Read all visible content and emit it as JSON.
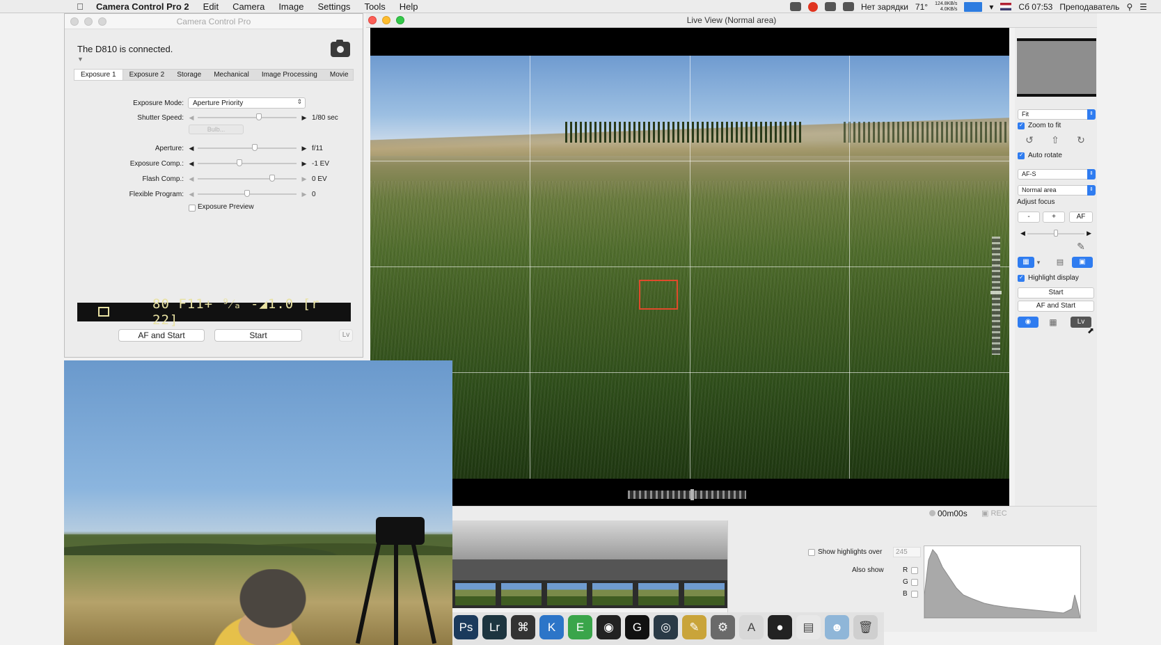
{
  "menubar": {
    "app_name": "Camera Control Pro 2",
    "items": [
      "Edit",
      "Camera",
      "Image",
      "Settings",
      "Tools",
      "Help"
    ],
    "status": {
      "battery": "Нет зарядки",
      "temperature": "71°",
      "net_up": "124.8KB/s",
      "net_down": "4.0KB/s",
      "clock": "Сб 07:53",
      "user": "Преподаватель"
    }
  },
  "ccp": {
    "title": "Camera Control Pro",
    "connection": "The D810 is connected.",
    "tabs": [
      "Exposure 1",
      "Exposure 2",
      "Storage",
      "Mechanical",
      "Image Processing",
      "Movie"
    ],
    "exposure_mode": {
      "label": "Exposure Mode:",
      "value": "Aperture Priority"
    },
    "shutter_speed": {
      "label": "Shutter Speed:",
      "value": "1/80 sec",
      "level": 0.62
    },
    "bulb_label": "Bulb...",
    "aperture": {
      "label": "Aperture:",
      "value": "f/11",
      "level": 0.58
    },
    "exposure_comp": {
      "label": "Exposure Comp.:",
      "value": "-1 EV",
      "level": 0.42
    },
    "flash_comp": {
      "label": "Flash Comp.:",
      "value": "0 EV",
      "level": 0.75
    },
    "flexible_program": {
      "label": "Flexible Program:",
      "value": "0",
      "level": 0.5
    },
    "exposure_preview": "Exposure Preview",
    "lcd_readout": "80 F11+ ⁹⁄ₐ -◢1.0 [r 22]",
    "buttons": {
      "af_and_start": "AF and Start",
      "start": "Start",
      "lv": "Lv"
    }
  },
  "live_view": {
    "title": "Live View (Normal area)",
    "timer": "00m00s",
    "rec_label": "REC"
  },
  "right_panel": {
    "zoom_select": "Fit",
    "zoom_to_fit": "Zoom to fit",
    "auto_rotate": "Auto rotate",
    "focus_mode": "AF-S",
    "area_mode": "Normal area",
    "adjust_focus": "Adjust focus",
    "focus_minus": "-",
    "focus_plus": "+",
    "focus_af": "AF",
    "highlight_display": "Highlight display",
    "start": "Start",
    "af_and_start": "AF and Start",
    "lv_button": "Lv"
  },
  "histogram": {
    "show_highlights_label": "Show highlights over",
    "threshold": "245",
    "also_show": "Also show",
    "channels": [
      "R",
      "G",
      "B"
    ]
  },
  "dock": {
    "apps": [
      {
        "name": "photoshop-icon",
        "label": "Ps",
        "color": "#1b3a5c"
      },
      {
        "name": "lightroom-icon",
        "label": "Lr",
        "color": "#1d3540"
      },
      {
        "name": "keyboard-icon",
        "label": "⌘",
        "color": "#333333"
      },
      {
        "name": "keynote-icon",
        "label": "K",
        "color": "#2c75c8"
      },
      {
        "name": "evernote-icon",
        "label": "E",
        "color": "#3aa54a"
      },
      {
        "name": "camera-app-icon",
        "label": "◉",
        "color": "#222222"
      },
      {
        "name": "github-icon",
        "label": "G",
        "color": "#111111"
      },
      {
        "name": "lens-icon",
        "label": "◎",
        "color": "#2a3a46"
      },
      {
        "name": "tools-icon",
        "label": "✎",
        "color": "#c9a43a"
      },
      {
        "name": "system-prefs-icon",
        "label": "⚙",
        "color": "#6a6a6a"
      },
      {
        "name": "pdf-icon",
        "label": "A",
        "color": "#d8d8d8"
      },
      {
        "name": "obs-icon",
        "label": "●",
        "color": "#222222"
      },
      {
        "name": "document-icon",
        "label": "▤",
        "color": "#e8e8e8"
      },
      {
        "name": "finder-icon",
        "label": "☻",
        "color": "#8fb6d8"
      },
      {
        "name": "trash-icon",
        "label": "🗑",
        "color": "#cfcfcf"
      }
    ]
  }
}
